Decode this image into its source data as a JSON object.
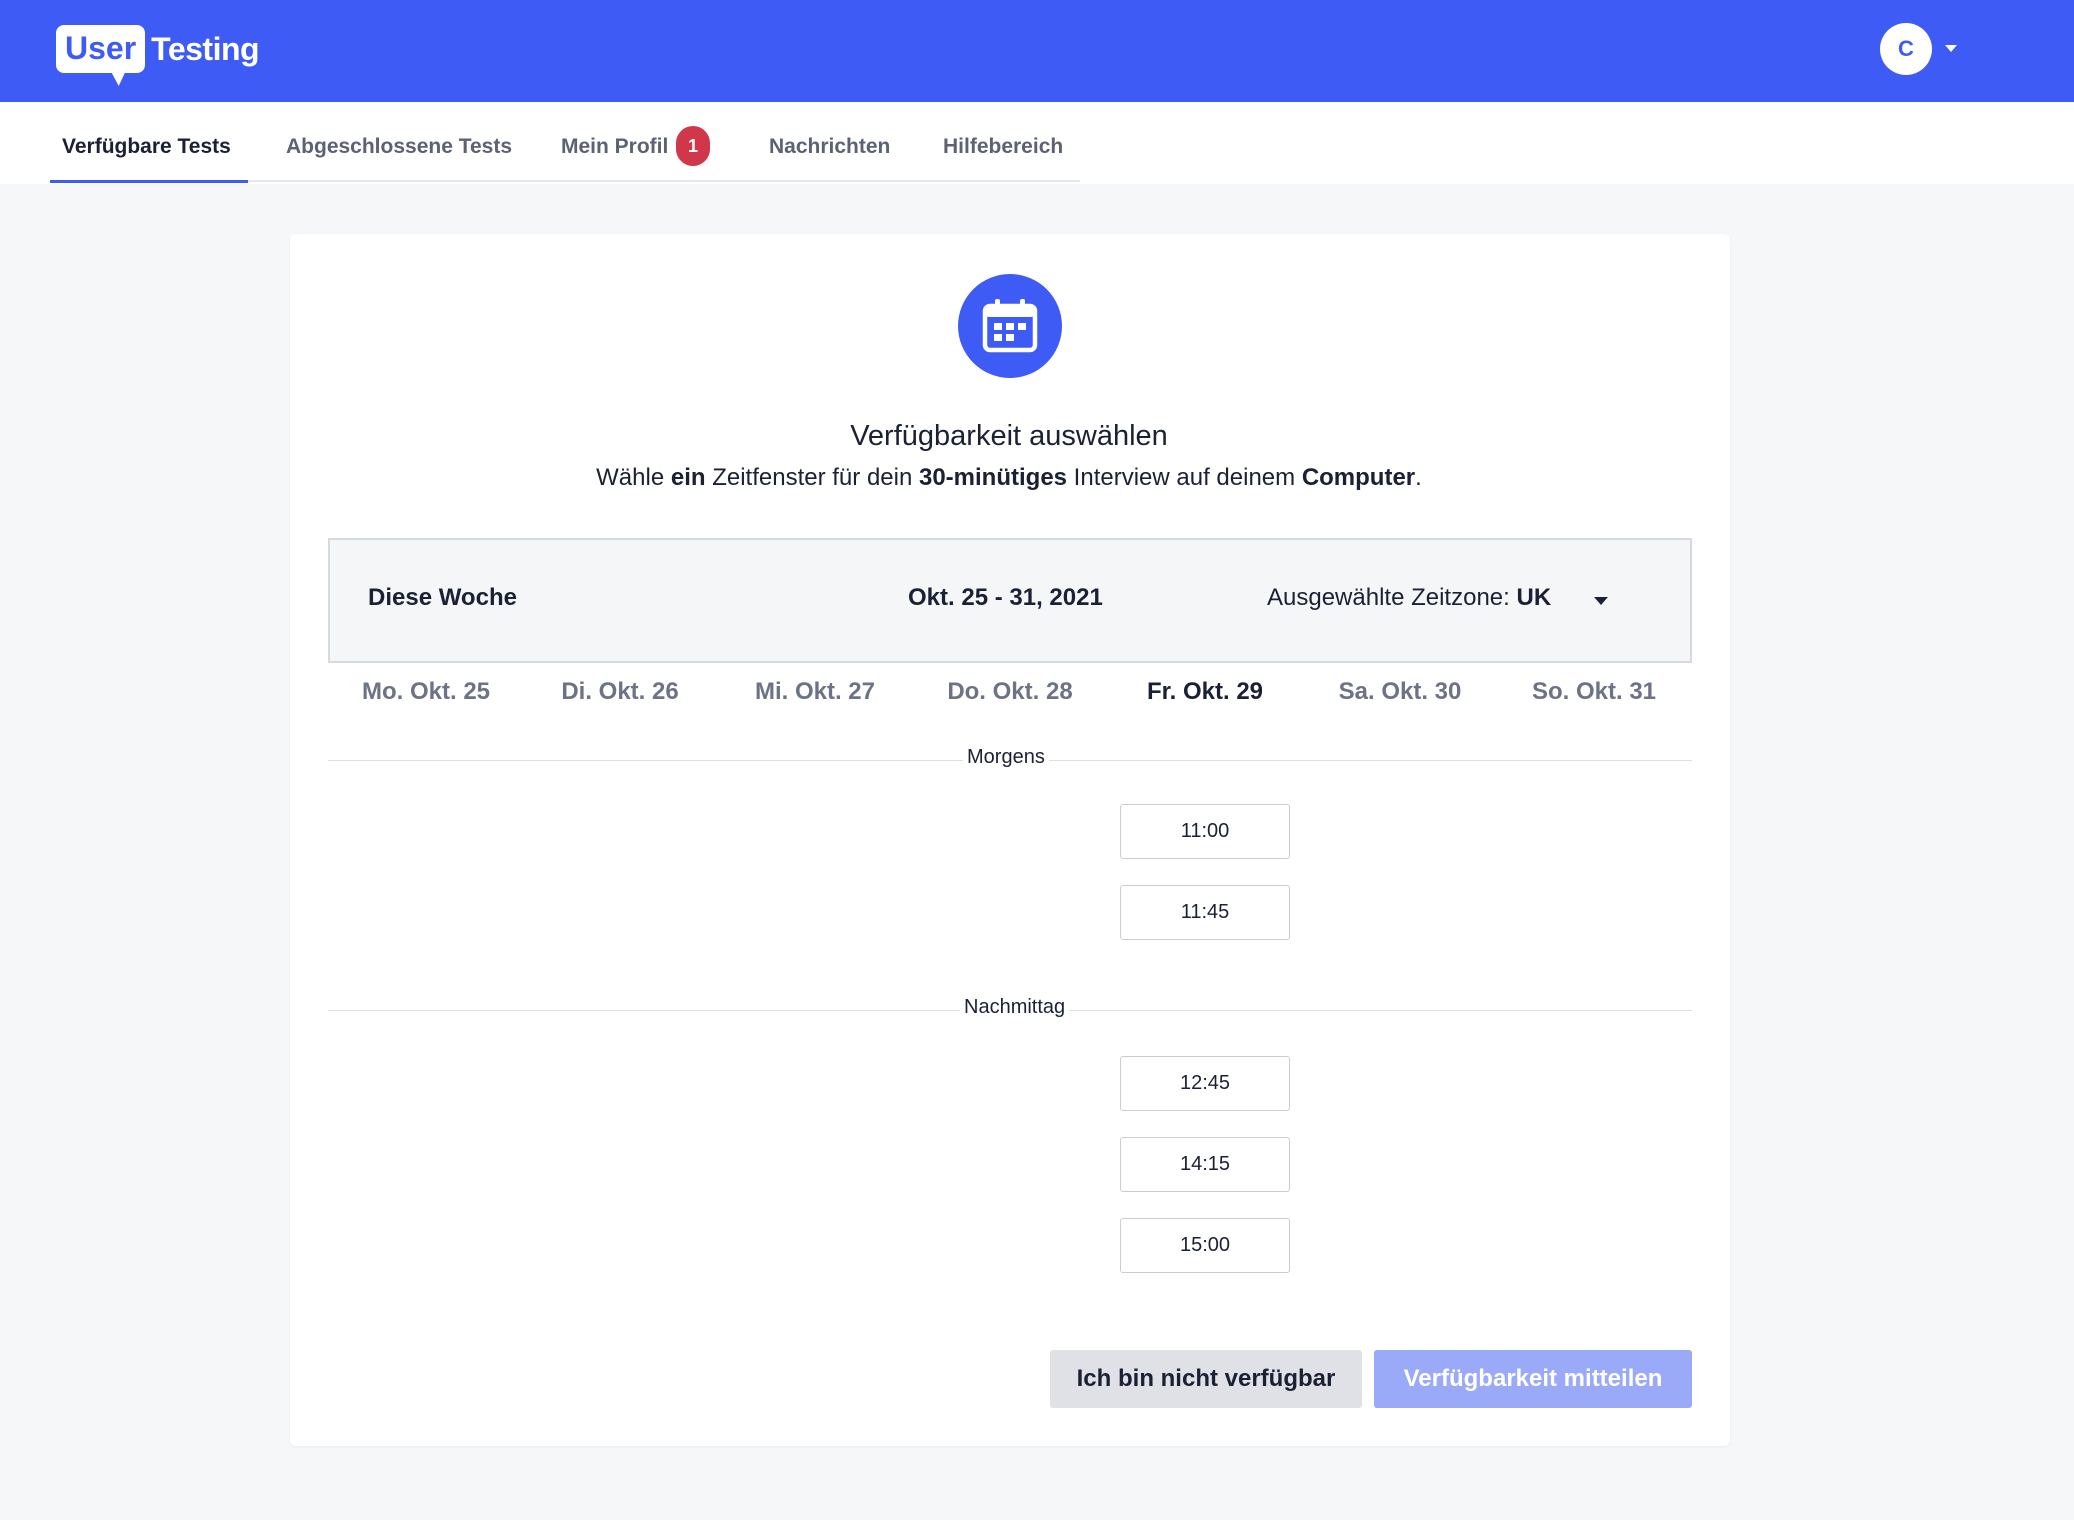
{
  "header": {
    "logo_user": "User",
    "logo_testing": "Testing",
    "avatar_initial": "C",
    "brand_color": "#3e5bf6"
  },
  "nav": {
    "tabs": [
      {
        "label": "Verfügbare Tests",
        "active": true
      },
      {
        "label": "Abgeschlossene Tests",
        "active": false
      },
      {
        "label": "Mein Profil",
        "active": false,
        "badge": "1"
      },
      {
        "label": "Nachrichten",
        "active": false
      },
      {
        "label": "Hilfebereich",
        "active": false
      }
    ]
  },
  "main": {
    "icon": "calendar-icon",
    "title": "Verfügbarkeit auswählen",
    "subtitle": {
      "p1": "Wähle ",
      "b1": "ein",
      "p2": " Zeitfenster für dein ",
      "b2": "30-minütiges",
      "p3": " Interview auf deinem ",
      "b3": "Computer",
      "p4": "."
    },
    "week": {
      "label": "Diese Woche",
      "range": "Okt. 25 - 31, 2021",
      "timezone_label": "Ausgewählte Zeitzone: ",
      "timezone_value": "UK"
    },
    "days": [
      {
        "label": "Mo. Okt. 25",
        "active": false
      },
      {
        "label": "Di. Okt. 26",
        "active": false
      },
      {
        "label": "Mi. Okt. 27",
        "active": false
      },
      {
        "label": "Do. Okt. 28",
        "active": false
      },
      {
        "label": "Fr. Okt. 29",
        "active": true
      },
      {
        "label": "Sa. Okt. 30",
        "active": false
      },
      {
        "label": "So. Okt. 31",
        "active": false
      }
    ],
    "morning": {
      "label": "Morgens",
      "slots": [
        "11:00",
        "11:45"
      ]
    },
    "afternoon": {
      "label": "Nachmittag",
      "slots": [
        "12:45",
        "14:15",
        "15:00"
      ]
    },
    "actions": {
      "not_available": "Ich bin nicht verfügbar",
      "submit": "Verfügbarkeit mitteilen"
    }
  }
}
